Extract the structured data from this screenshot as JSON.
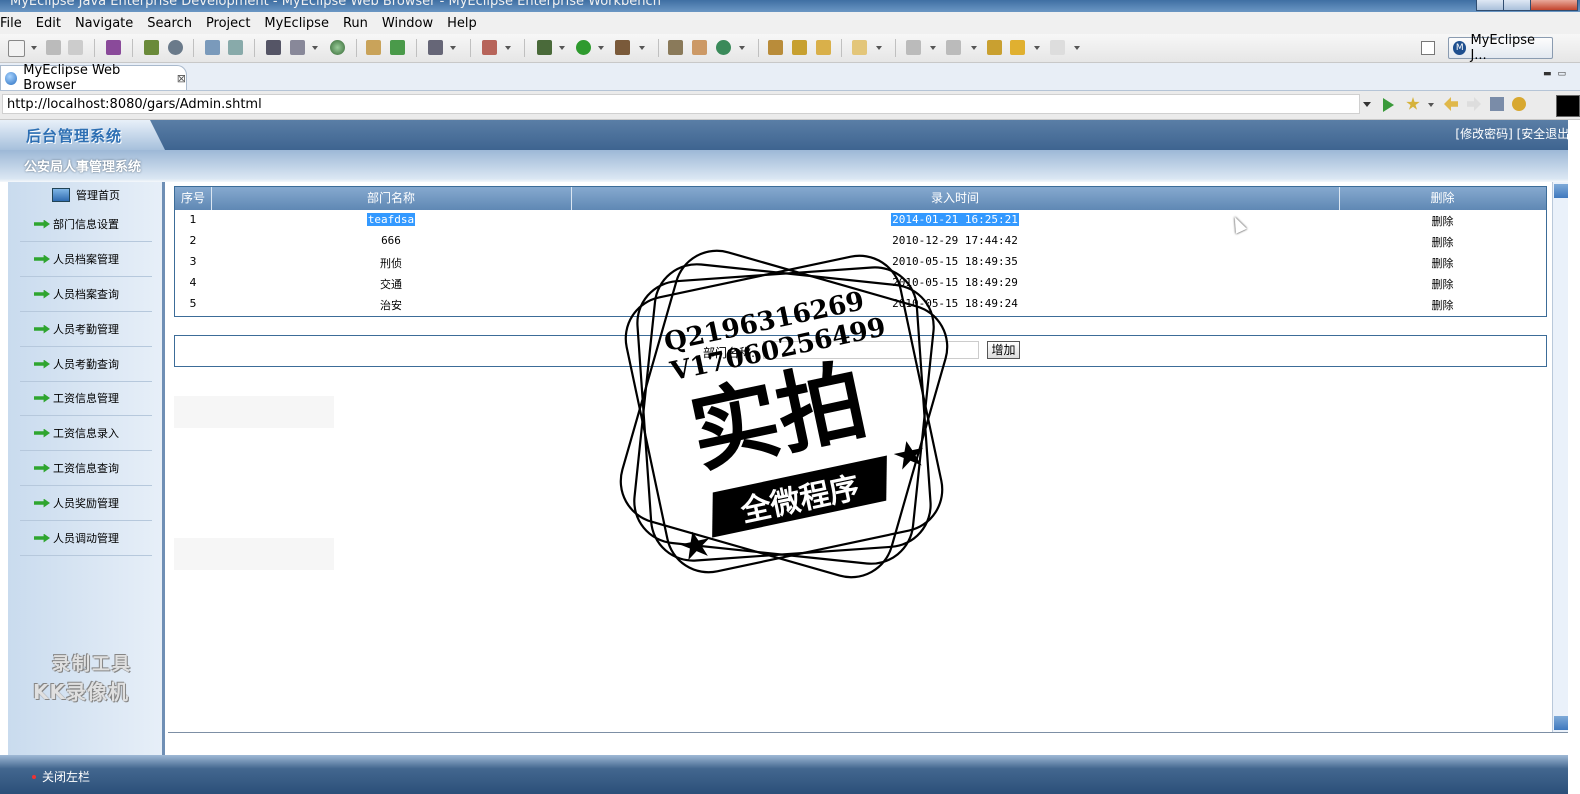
{
  "window": {
    "title": "MyEclipse Java Enterprise Development - MyEclipse Web Browser - MyEclipse Enterprise Workbench"
  },
  "menu": [
    "File",
    "Edit",
    "Navigate",
    "Search",
    "Project",
    "MyEclipse",
    "Run",
    "Window",
    "Help"
  ],
  "perspective": {
    "label": "MyEclipse J...",
    "icon": "myeclipse-perspective-icon"
  },
  "editor_tab": {
    "label": "MyEclipse Web Browser",
    "icon": "globe-icon"
  },
  "url": {
    "value": "http://localhost:8080/gars/Admin.shtml"
  },
  "webapp": {
    "logo": "后台管理系统",
    "links": {
      "change_password": "[修改密码]",
      "logout": "[安全退出]"
    },
    "system_name": "公安局人事管理系统",
    "home": "管理首页",
    "nav": [
      "部门信息设置",
      "人员档案管理",
      "人员档案查询",
      "人员考勤管理",
      "人员考勤查询",
      "工资信息管理",
      "工资信息录入",
      "工资信息查询",
      "人员奖励管理",
      "人员调动管理"
    ],
    "table": {
      "headers": [
        "序号",
        "部门名称",
        "录入时间",
        "删除"
      ],
      "rows": [
        {
          "no": "1",
          "name": "teafdsa",
          "time": "2014-01-21 16:25:21",
          "action": "删除"
        },
        {
          "no": "2",
          "name": "666",
          "time": "2010-12-29 17:44:42",
          "action": "删除"
        },
        {
          "no": "3",
          "name": "刑侦",
          "time": "2010-05-15 18:49:35",
          "action": "删除"
        },
        {
          "no": "4",
          "name": "交通",
          "time": "2010-05-15 18:49:29",
          "action": "删除"
        },
        {
          "no": "5",
          "name": "治安",
          "time": "2010-05-15 18:49:24",
          "action": "删除"
        }
      ]
    },
    "add_form": {
      "label": "部门名称:",
      "value": "",
      "button": "增加"
    },
    "footer": {
      "close_sidebar": "关闭左栏"
    }
  },
  "watermarks": {
    "recorder_line1": "录制工具",
    "recorder_line2": "KK录像机",
    "stamp_q": "Q2196316269",
    "stamp_v": "V17060256499",
    "stamp_main": "实拍",
    "stamp_banner": "全微程序"
  },
  "colors": {
    "header_blue": "#3e6490",
    "selection": "#3399ff",
    "grid_border": "#3c6c98"
  }
}
